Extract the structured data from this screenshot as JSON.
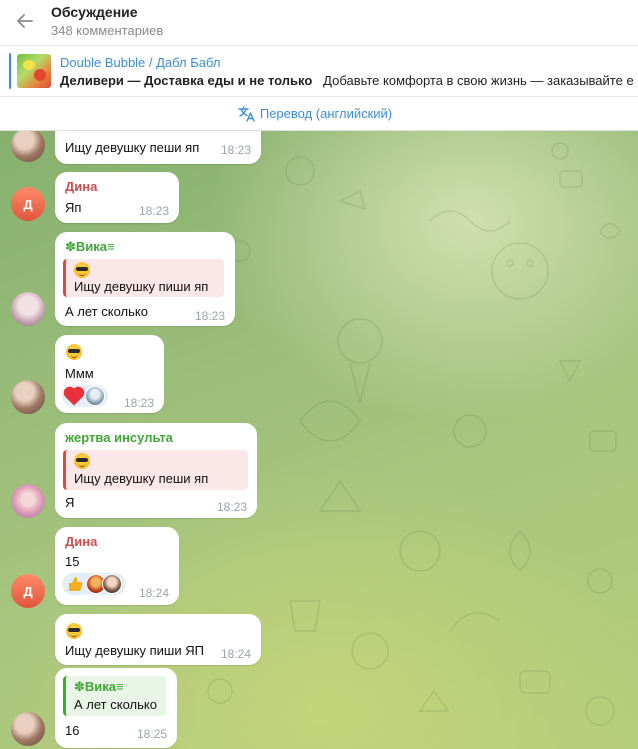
{
  "header": {
    "title": "Обсуждение",
    "subtitle": "348 комментариев"
  },
  "pinned": {
    "title": "Double Bubble / Дабл Бабл",
    "bold_text": "Деливери — Доставка еды и не только",
    "text": "Добавьте комфорта в свою жизнь — заказывайте е"
  },
  "translate": {
    "label": "Перевод (английский)"
  },
  "messages": [
    {
      "text": "Ищу девушку пеши яп",
      "time": "18:23"
    },
    {
      "sender": "Дина",
      "avatar_letter": "Д",
      "text": "Яп",
      "time": "18:23"
    },
    {
      "sender": "✽Вика≡",
      "quote_text": "Ищу девушку пиши яп",
      "text": "А лет сколько",
      "time": "18:23"
    },
    {
      "text": "Ммм",
      "time": "18:23"
    },
    {
      "sender": "жертва инсульта",
      "quote_text": "Ищу девушку пеши яп",
      "text": "Я",
      "time": "18:23"
    },
    {
      "sender": "Дина",
      "avatar_letter": "Д",
      "text": "15",
      "time": "18:24"
    },
    {
      "text": "Ищу девушку пиши ЯП",
      "time": "18:24"
    },
    {
      "quote_name": "✽Вика≡",
      "quote_text": "А лет сколько",
      "text": "16",
      "time": "18:25"
    }
  ],
  "colors": {
    "accent": "#3a8fd9",
    "sender_red": "#d64a4a",
    "sender_green": "#3ea735"
  }
}
